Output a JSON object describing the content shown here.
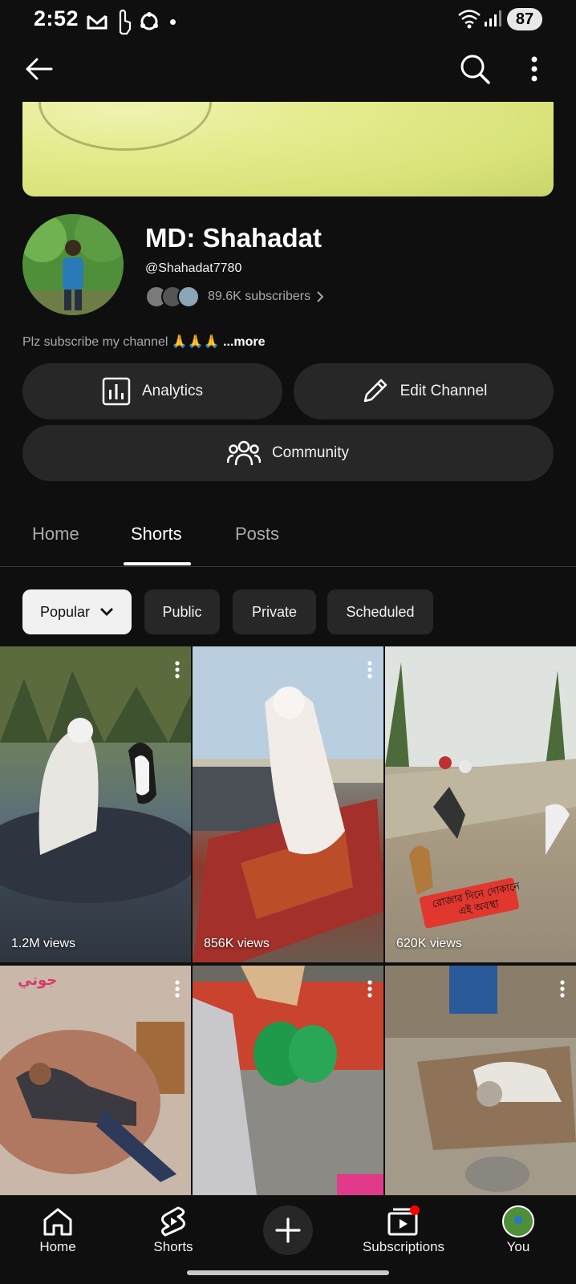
{
  "status_bar": {
    "time": "2:52",
    "battery": "87"
  },
  "channel": {
    "name": "MD: Shahadat",
    "handle": "@Shahadat7780",
    "subscribers": "89.6K subscribers",
    "description": "Plz subscribe my channel 🙏🙏🙏",
    "more_label": "...more"
  },
  "actions": {
    "analytics_label": "Analytics",
    "edit_label": "Edit Channel",
    "community_label": "Community"
  },
  "tabs": [
    {
      "label": "Home"
    },
    {
      "label": "Shorts"
    },
    {
      "label": "Posts"
    }
  ],
  "chips": [
    {
      "label": "Popular"
    },
    {
      "label": "Public"
    },
    {
      "label": "Private"
    },
    {
      "label": "Scheduled"
    }
  ],
  "shorts": [
    {
      "views": "1.2M views"
    },
    {
      "views": "856K views"
    },
    {
      "views": "620K views"
    },
    {
      "views": ""
    },
    {
      "views": ""
    },
    {
      "views": ""
    }
  ],
  "overlay_texts": {
    "tile4_caption": "جوتي",
    "tile3_caption": "রোজার দিনে দোকানে এই অবস্থা"
  },
  "bottom_nav": {
    "home": "Home",
    "shorts": "Shorts",
    "subscriptions": "Subscriptions",
    "you": "You"
  },
  "colors": {
    "background": "#0f0f0f",
    "surface": "#272727",
    "notification": "#ff0000"
  }
}
